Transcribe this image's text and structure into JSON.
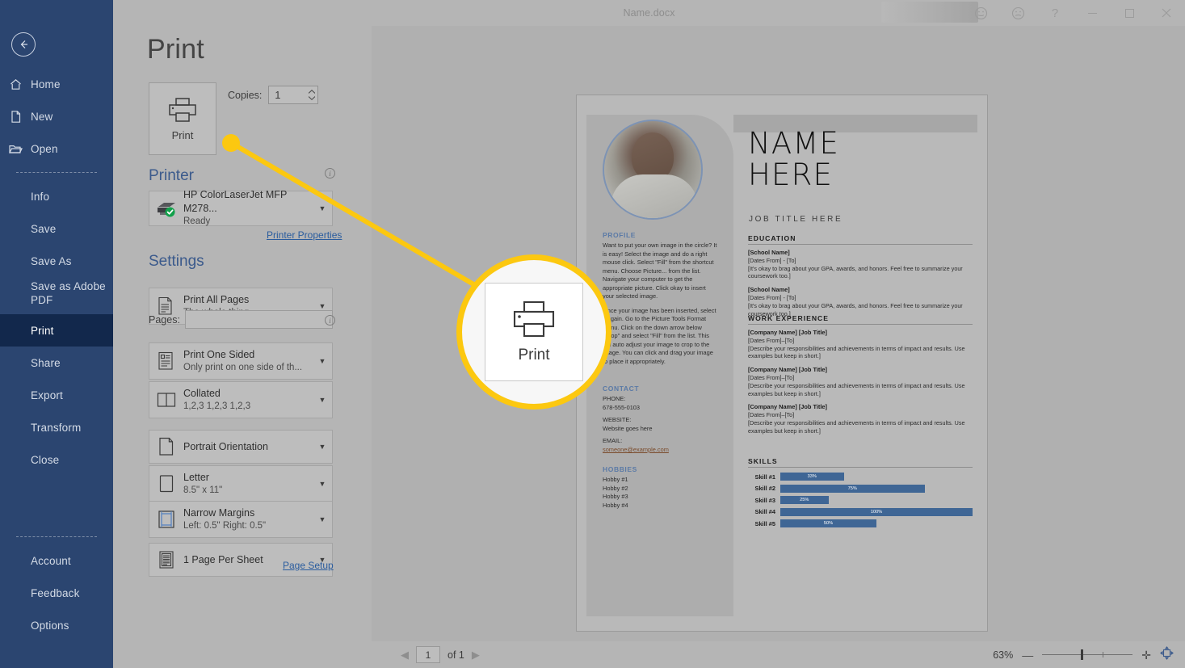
{
  "window": {
    "title": "Name.docx",
    "controls": [
      "smile-icon",
      "frown-icon",
      "help-icon",
      "minimize-icon",
      "maximize-icon",
      "close-icon"
    ]
  },
  "sidebar": {
    "back_label": "Back",
    "items": [
      {
        "label": "Home",
        "icon": "home-icon",
        "indent": false,
        "active": false
      },
      {
        "label": "New",
        "icon": "new-document-icon",
        "indent": false,
        "active": false
      },
      {
        "label": "Open",
        "icon": "folder-open-icon",
        "indent": false,
        "active": false
      },
      {
        "label": "Info",
        "icon": "",
        "indent": true,
        "active": false
      },
      {
        "label": "Save",
        "icon": "",
        "indent": true,
        "active": false
      },
      {
        "label": "Save As",
        "icon": "",
        "indent": true,
        "active": false
      },
      {
        "label": "Save as Adobe PDF",
        "icon": "",
        "indent": true,
        "active": false
      },
      {
        "label": "Print",
        "icon": "",
        "indent": true,
        "active": true
      },
      {
        "label": "Share",
        "icon": "",
        "indent": true,
        "active": false
      },
      {
        "label": "Export",
        "icon": "",
        "indent": true,
        "active": false
      },
      {
        "label": "Transform",
        "icon": "",
        "indent": true,
        "active": false
      },
      {
        "label": "Close",
        "icon": "",
        "indent": true,
        "active": false
      },
      {
        "label": "Account",
        "icon": "",
        "indent": true,
        "active": false
      },
      {
        "label": "Feedback",
        "icon": "",
        "indent": true,
        "active": false
      },
      {
        "label": "Options",
        "icon": "",
        "indent": true,
        "active": false
      }
    ]
  },
  "print": {
    "page_title": "Print",
    "print_button_label": "Print",
    "copies_label": "Copies:",
    "copies_value": "1",
    "printer_heading": "Printer",
    "printer_name": "HP ColorLaserJet MFP M278...",
    "printer_status": "Ready",
    "printer_properties_link": "Printer Properties",
    "settings_heading": "Settings",
    "pages_label": "Pages:",
    "pages_value": "",
    "page_setup_link": "Page Setup",
    "options": [
      {
        "title": "Print All Pages",
        "subtitle": "The whole thing",
        "icon": "print-all-pages-icon"
      },
      {
        "title": "Print One Sided",
        "subtitle": "Only print on one side of th...",
        "icon": "one-sided-icon"
      },
      {
        "title": "Collated",
        "subtitle": "1,2,3   1,2,3   1,2,3",
        "icon": "collated-icon"
      },
      {
        "title": "Portrait Orientation",
        "subtitle": "",
        "icon": "portrait-icon"
      },
      {
        "title": "Letter",
        "subtitle": "8.5\" x 11\"",
        "icon": "paper-size-icon"
      },
      {
        "title": "Narrow Margins",
        "subtitle": "Left:  0.5\"   Right:  0.5\"",
        "icon": "margins-icon"
      },
      {
        "title": "1 Page Per Sheet",
        "subtitle": "",
        "icon": "pages-per-sheet-icon"
      }
    ]
  },
  "callout": {
    "label": "Print",
    "icon": "printer-icon",
    "highlight_color": "#fcc810"
  },
  "status": {
    "page_current": "1",
    "page_of": "of 1",
    "zoom_percent": "63%",
    "prev_icon": "previous-page-icon",
    "next_icon": "next-page-icon",
    "zoom_out_icon": "zoom-out-icon",
    "zoom_in_icon": "zoom-in-icon",
    "fit_page_icon": "fit-to-page-icon"
  },
  "document": {
    "name": "NAME\nHERE",
    "name_line1": "NAME",
    "name_line2": "HERE",
    "job_title": "JOB TITLE HERE",
    "profile_heading": "PROFILE",
    "profile_p1": "Want to put your own image in the circle?  It is easy!  Select the image and do a right mouse click.  Select \"Fill\" from the shortcut menu.  Choose Picture... from the list.  Navigate your computer to get the appropriate picture.  Click okay to insert your selected image.",
    "profile_p2": "Once your image has been inserted, select it again.  Go to the Picture Tools Format menu. Click on the down arrow below \"Crop\" and select \"Fill\" from the list.  This will auto adjust your image to crop to the image.  You can click and drag your image to place it appropriately.",
    "contact_heading": "CONTACT",
    "contact": [
      {
        "label": "PHONE:",
        "value": "678-555-0103",
        "link": false
      },
      {
        "label": "WEBSITE:",
        "value": "Website goes here",
        "link": false
      },
      {
        "label": "EMAIL:",
        "value": "someone@example.com",
        "link": true
      }
    ],
    "hobbies_heading": "HOBBIES",
    "hobbies": [
      "Hobby #1",
      "Hobby #2",
      "Hobby #3",
      "Hobby #4"
    ],
    "education_heading": "EDUCATION",
    "education": [
      {
        "title": "[School Name]",
        "dates": "[Dates From] - [To]",
        "desc": "[It's okay to brag about your GPA, awards, and honors. Feel free to summarize your coursework too.]"
      },
      {
        "title": "[School Name]",
        "dates": "[Dates From] - [To]",
        "desc": "[It's okay to brag about your GPA, awards, and honors. Feel free to summarize your coursework too.]"
      }
    ],
    "work_heading": "WORK EXPERIENCE",
    "work": [
      {
        "title": "[Company Name]  [Job Title]",
        "dates": "[Dates From]–[To]",
        "desc": "[Describe your responsibilities and achievements in terms of impact and results. Use examples but keep in short.]"
      },
      {
        "title": "[Company Name]  [Job Title]",
        "dates": "[Dates From]–[To]",
        "desc": "[Describe your responsibilities and achievements in terms of impact and results. Use examples but keep in short.]"
      },
      {
        "title": "[Company Name]  [Job Title]",
        "dates": "[Dates From]–[To]",
        "desc": "[Describe your responsibilities and achievements in terms of impact and results. Use examples but keep in short.]"
      }
    ],
    "skills_heading": "SKILLS",
    "skills": [
      {
        "name": "Skill #1",
        "value": 33,
        "label": "33%"
      },
      {
        "name": "Skill #2",
        "value": 75,
        "label": "75%"
      },
      {
        "name": "Skill #3",
        "value": 25,
        "label": "25%"
      },
      {
        "name": "Skill #4",
        "value": 100,
        "label": "100%"
      },
      {
        "name": "Skill #5",
        "value": 50,
        "label": "50%"
      }
    ]
  },
  "colors": {
    "sidebar": "#2b4570",
    "sidebar_active": "#12284c",
    "accent_blue": "#3b5a8c",
    "link": "#2a5c9e",
    "highlight": "#fcc810",
    "skill_bar": "#3f6695",
    "chrome": "#b5b5b5"
  }
}
